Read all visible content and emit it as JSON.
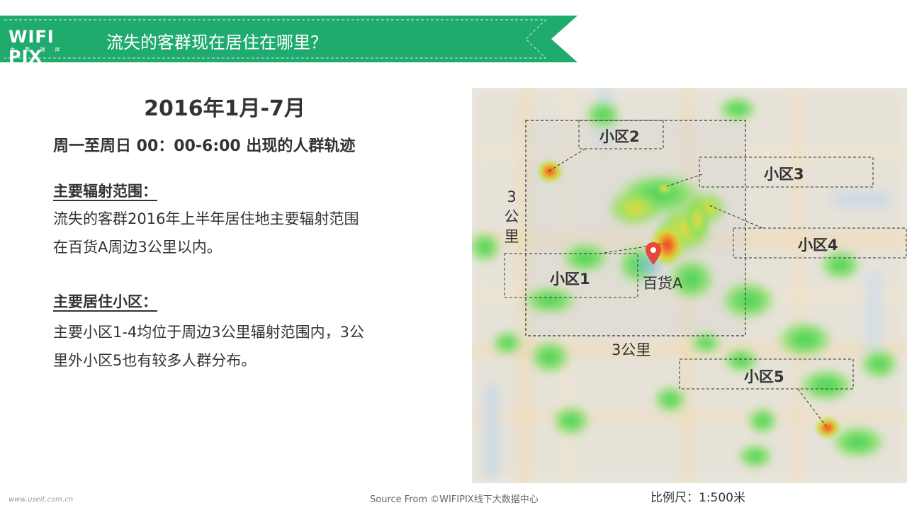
{
  "header": {
    "logo_text": "WIFI PIX",
    "logo_sub": "大 数 据 库",
    "title": "流失的客群现在居住在哪里？",
    "accent_color": "#1faa6e"
  },
  "left": {
    "period": "2016年1月-7月",
    "subtitle": "周一至周日 00：00-6:00 出现的人群轨迹",
    "section1": {
      "heading": "主要辐射范围：",
      "lines": [
        "流失的客群2016年上半年居住地主要辐射范围",
        "在百货A周边3公里以内。"
      ]
    },
    "section2": {
      "heading": "主要居住小区：",
      "lines": [
        "主要小区1-4均位于周边3公里辐射范围内，3公",
        "里外小区5也有较多人群分布。"
      ]
    }
  },
  "map": {
    "areas": [
      "小区1",
      "小区2",
      "小区3",
      "小区4",
      "小区5"
    ],
    "store_label": "百货A",
    "range_horizontal": "3公里",
    "range_vertical": [
      "3",
      "公",
      "里"
    ],
    "pin_color": "#e8463a"
  },
  "footer": {
    "source": "Source From ©WIFIPIX线下大数据中心",
    "scale": "比例尺：1:500米",
    "watermark": "www.useit.com.cn"
  }
}
